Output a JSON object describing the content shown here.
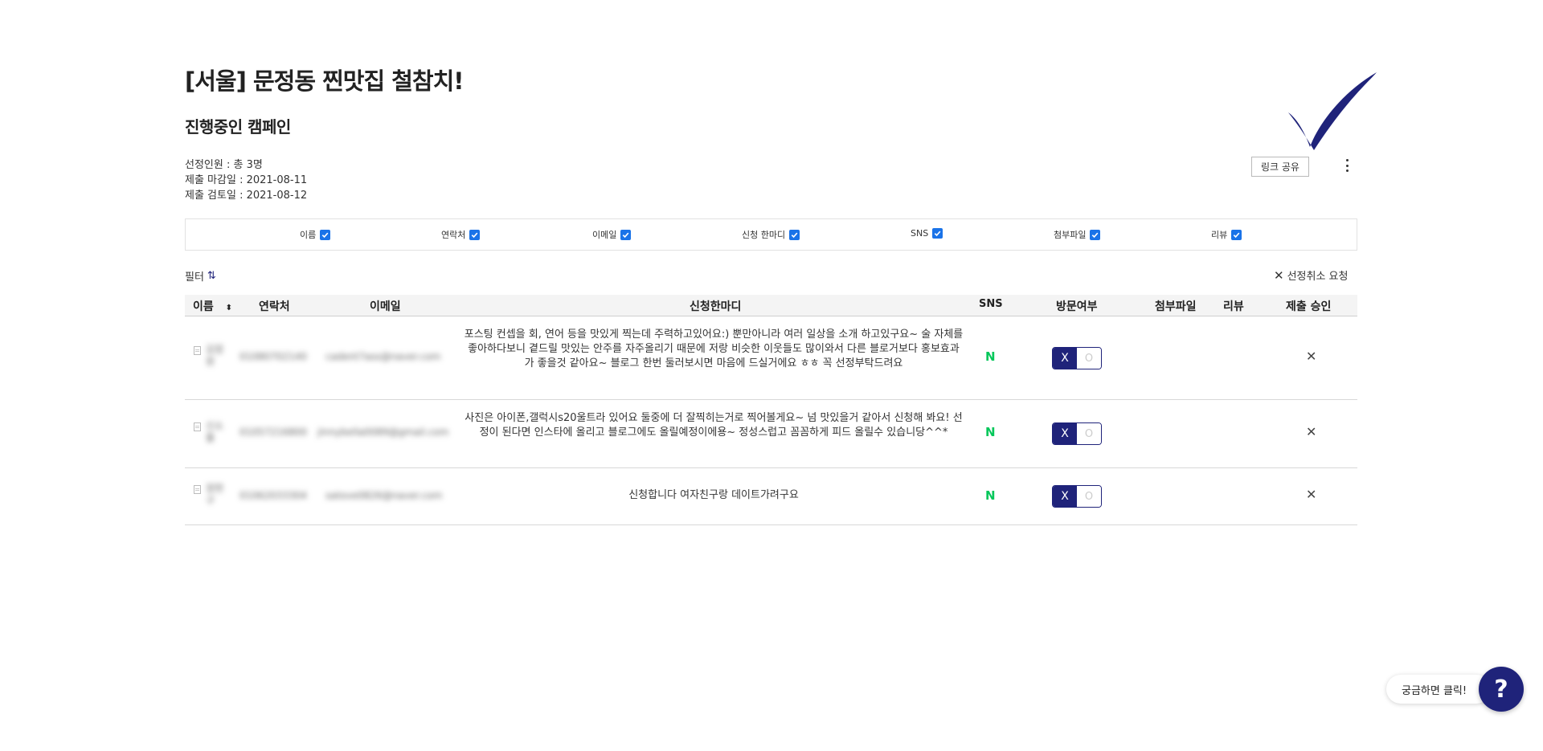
{
  "campaign": {
    "title": "[서울] 문정동 찐맛집 철참치!",
    "subtitle": "진행중인 캠페인",
    "selected_count": "선정인원 : 총 3명",
    "submit_deadline": "제출 마감일 : 2021-08-11",
    "review_date": "제출 검토일 : 2021-08-12"
  },
  "toolbar": {
    "share_label": "링크 공유"
  },
  "column_toggles": [
    {
      "label": "이름",
      "checked": true
    },
    {
      "label": "연락처",
      "checked": true
    },
    {
      "label": "이메일",
      "checked": true
    },
    {
      "label": "신청 한마디",
      "checked": true
    },
    {
      "label": "SNS",
      "checked": true
    },
    {
      "label": "첨부파일",
      "checked": true
    },
    {
      "label": "리뷰",
      "checked": true
    }
  ],
  "filter": {
    "label": "필터",
    "cancel_label": "선정취소 요청"
  },
  "table": {
    "headers": {
      "name": "이름",
      "contact": "연락처",
      "email": "이메일",
      "comment": "신청한마디",
      "sns": "SNS",
      "visit": "방문여부",
      "attachment": "첨부파일",
      "review": "리뷰",
      "approval": "제출 승인"
    },
    "rows": [
      {
        "name": "김정원",
        "phone": "01080702140",
        "email": "cadent7ass@naver.com",
        "comment": "포스팅 컨셉을 회, 연어 등을 맛있게 찍는데 주력하고있어요:) 뿐만아니라 여러 일상을 소개 하고있구요~ 술 자체를 좋아하다보니 곁드릴 맛있는 안주를 자주올리기 때문에 저랑 비슷한 이웃들도 많이와서 다른 블로거보다 홍보효과가 좋을것 같아요~ 블로그 한번 둘러보시면 마음에 드실거에요 ㅎㅎ 꼭 선정부탁드려요",
        "sns": "N",
        "visit_x": "X",
        "visit_o": "O",
        "approval": "✕"
      },
      {
        "name": "신소율",
        "phone": "01057216800",
        "email": "jinnybella0089@gmail.com",
        "comment": "사진은 아이폰,갤럭시s20울트라 있어요 둘중에 더 잘찍히는거로 찍어볼게요~ 넘 맛있을거 같아서 신청해 봐요! 선정이 된다면 인스타에 올리고 블로그에도 올릴예정이에용~ 정성스럽고 꼼꼼하게 피드 올릴수 있습니당^^*",
        "sns": "N",
        "visit_x": "X",
        "visit_o": "O",
        "approval": "✕"
      },
      {
        "name": "정현구",
        "phone": "01062033304",
        "email": "satove0826@naver.com",
        "comment": "신청합니다 여자친구랑 데이트가려구요",
        "sns": "N",
        "visit_x": "X",
        "visit_o": "O",
        "approval": "✕"
      }
    ]
  },
  "help": {
    "label": "궁금하면 클릭!",
    "button": "?"
  },
  "colors": {
    "accent": "#1f237a",
    "checkbox": "#1a73e8",
    "naver_green": "#03c75a"
  }
}
